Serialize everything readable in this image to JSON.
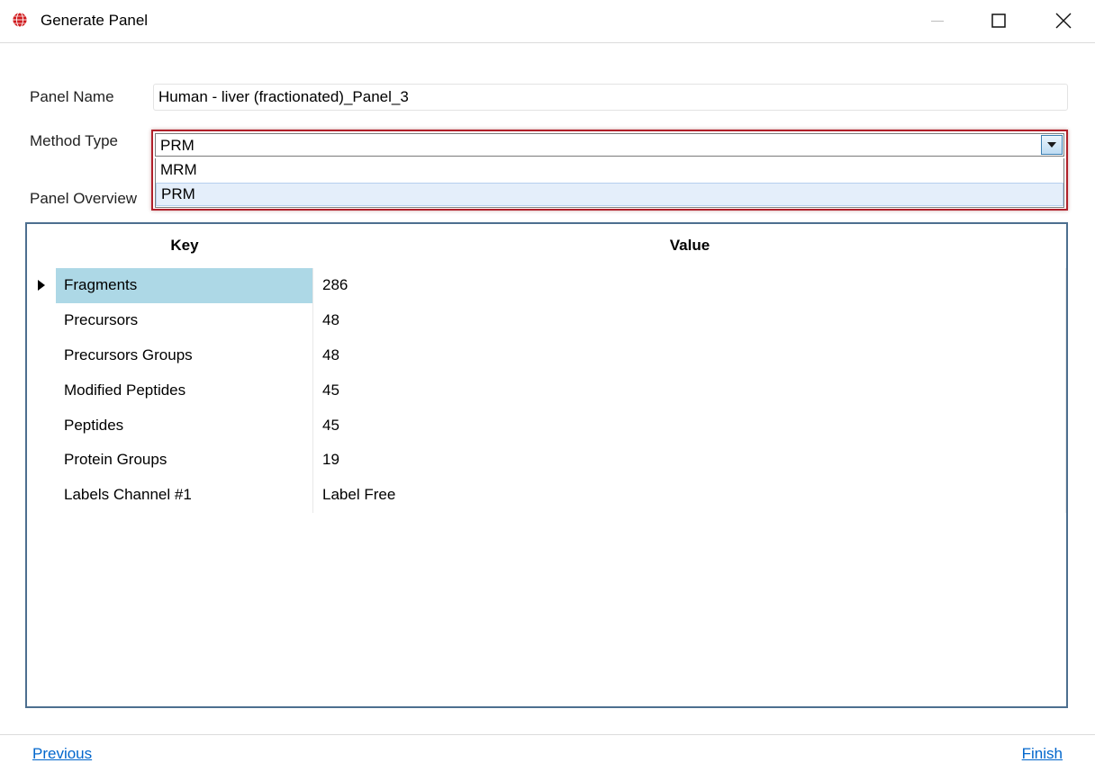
{
  "window": {
    "title": "Generate Panel",
    "icon": "globe-app-icon"
  },
  "form": {
    "panel_name_label": "Panel Name",
    "panel_name_value": "Human - liver (fractionated)_Panel_3",
    "method_type_label": "Method Type",
    "method_type_selected": "PRM",
    "method_type_options": [
      "MRM",
      "PRM"
    ],
    "panel_overview_label": "Panel Overview"
  },
  "grid": {
    "columns": {
      "key": "Key",
      "value": "Value"
    },
    "rows": [
      {
        "key": "Fragments",
        "value": "286",
        "selected": true
      },
      {
        "key": "Precursors",
        "value": "48"
      },
      {
        "key": "Precursors Groups",
        "value": "48"
      },
      {
        "key": "Modified Peptides",
        "value": "45"
      },
      {
        "key": "Peptides",
        "value": "45"
      },
      {
        "key": "Protein Groups",
        "value": "19"
      },
      {
        "key": "Labels Channel #1",
        "value": "Label Free"
      }
    ]
  },
  "footer": {
    "previous_label": "Previous",
    "finish_label": "Finish"
  },
  "colors": {
    "highlight_frame": "#b0202a",
    "selected_cell": "#add8e6",
    "link": "#0066cc",
    "grid_border": "#4d6f8f"
  }
}
